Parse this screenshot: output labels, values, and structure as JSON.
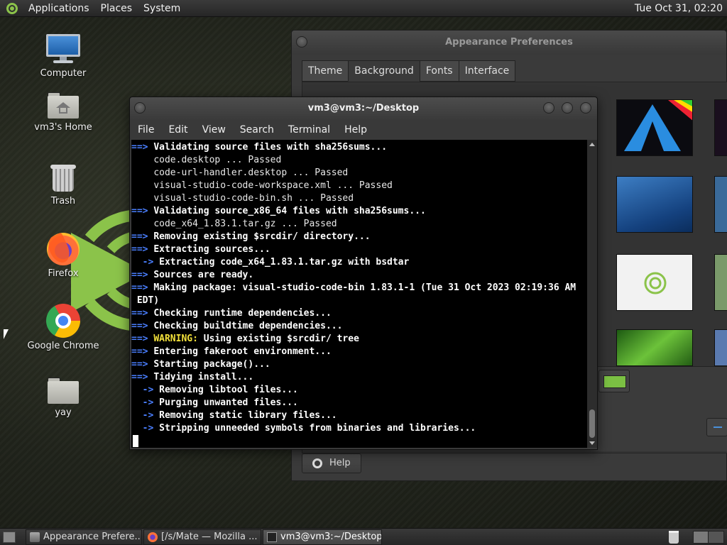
{
  "top_panel": {
    "menus": [
      "Applications",
      "Places",
      "System"
    ],
    "clock": "Tue Oct 31, 02:20"
  },
  "desktop": {
    "icons": [
      {
        "label": "Computer",
        "icon": "computer-icon"
      },
      {
        "label": "vm3's Home",
        "icon": "home-folder-icon"
      },
      {
        "label": "Trash",
        "icon": "trash-icon"
      },
      {
        "label": "Firefox",
        "icon": "firefox-icon"
      },
      {
        "label": "Google Chrome",
        "icon": "chrome-icon"
      },
      {
        "label": "yay",
        "icon": "folder-icon"
      }
    ]
  },
  "appearance": {
    "title": "Appearance Preferences",
    "tabs": [
      "Theme",
      "Background",
      "Fonts",
      "Interface"
    ],
    "active_tab": "Background",
    "help_label": "Help",
    "selected_color": "#7bc043"
  },
  "terminal": {
    "title": "vm3@vm3:~/Desktop",
    "menus": [
      "File",
      "Edit",
      "View",
      "Search",
      "Terminal",
      "Help"
    ],
    "lines": [
      {
        "prefix": "==> ",
        "text": "Validating source files with sha256sums...",
        "style": "bold"
      },
      {
        "prefix": "    ",
        "text": "code.desktop ... Passed",
        "style": "normal"
      },
      {
        "prefix": "    ",
        "text": "code-url-handler.desktop ... Passed",
        "style": "normal"
      },
      {
        "prefix": "    ",
        "text": "visual-studio-code-workspace.xml ... Passed",
        "style": "normal"
      },
      {
        "prefix": "    ",
        "text": "visual-studio-code-bin.sh ... Passed",
        "style": "normal"
      },
      {
        "prefix": "==> ",
        "text": "Validating source_x86_64 files with sha256sums...",
        "style": "bold"
      },
      {
        "prefix": "    ",
        "text": "code_x64_1.83.1.tar.gz ... Passed",
        "style": "normal"
      },
      {
        "prefix": "==> ",
        "text": "Removing existing $srcdir/ directory...",
        "style": "bold"
      },
      {
        "prefix": "==> ",
        "text": "Extracting sources...",
        "style": "bold"
      },
      {
        "prefix": "  -> ",
        "text": "Extracting code_x64_1.83.1.tar.gz with bsdtar",
        "style": "bold"
      },
      {
        "prefix": "==> ",
        "text": "Sources are ready.",
        "style": "bold"
      },
      {
        "prefix": "==> ",
        "text": "Making package: visual-studio-code-bin 1.83.1-1 (Tue 31 Oct 2023 02:19:36 AM",
        "style": "bold"
      },
      {
        "prefix": " ",
        "text": "EDT)",
        "style": "bold"
      },
      {
        "prefix": "==> ",
        "text": "Checking runtime dependencies...",
        "style": "bold"
      },
      {
        "prefix": "==> ",
        "text": "Checking buildtime dependencies...",
        "style": "bold"
      },
      {
        "prefix": "==> ",
        "warn": "WARNING:",
        "text": " Using existing $srcdir/ tree",
        "style": "bold"
      },
      {
        "prefix": "==> ",
        "text": "Entering fakeroot environment...",
        "style": "bold"
      },
      {
        "prefix": "==> ",
        "text": "Starting package()...",
        "style": "bold"
      },
      {
        "prefix": "==> ",
        "text": "Tidying install...",
        "style": "bold"
      },
      {
        "prefix": "  -> ",
        "text": "Removing libtool files...",
        "style": "bold"
      },
      {
        "prefix": "  -> ",
        "text": "Purging unwanted files...",
        "style": "bold"
      },
      {
        "prefix": "  -> ",
        "text": "Removing static library files...",
        "style": "bold"
      },
      {
        "prefix": "  -> ",
        "text": "Stripping unneeded symbols from binaries and libraries...",
        "style": "bold"
      }
    ]
  },
  "taskbar": {
    "tasks": [
      {
        "label": "Appearance Prefere...",
        "icon": "appearance-icon",
        "active": false
      },
      {
        "label": "[/s/Mate — Mozilla ...",
        "icon": "firefox-icon",
        "active": false
      },
      {
        "label": "vm3@vm3:~/Desktop",
        "icon": "terminal-icon",
        "active": true
      }
    ]
  }
}
